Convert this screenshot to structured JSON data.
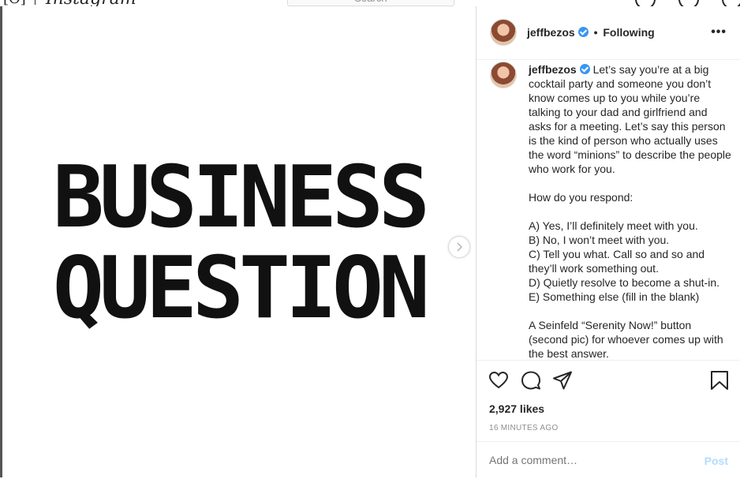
{
  "header": {
    "logo_fragment": "[O]",
    "brand_fragment": "Instagram",
    "search_placeholder": "Search"
  },
  "media": {
    "title_line1": "BUSINESS",
    "title_line2": "QUESTION",
    "next_icon": "chevron-right-icon"
  },
  "post": {
    "username": "jeffbezos",
    "separator": "•",
    "follow_status": "Following",
    "more_label": "•••",
    "caption_user": "jeffbezos",
    "caption_text": " Let’s say you’re at a big cocktail party and someone you don’t know comes up to you while you’re talking to your dad and girlfriend and asks for a meeting. Let’s say this person is the kind of person who actually uses the word “minions” to describe the people who work for you.\n\nHow do you respond:\n\nA) Yes, I’ll definitely meet with you.\nB) No, I won’t meet with you.\nC) Tell you what. Call so and so and they’ll work something out.\nD) Quietly resolve to become a shut-in.\nE) Something else (fill in the blank)\n\nA Seinfeld “Serenity Now!” button (second pic) for whoever comes up with the best answer.",
    "likes": "2,927 likes",
    "time": "16 MINUTES AGO",
    "comment_placeholder": "Add a comment…",
    "post_label": "Post",
    "colors": {
      "verified": "#3897f0",
      "post_disabled": "#b3dbff",
      "muted": "#8e8e8e"
    }
  }
}
